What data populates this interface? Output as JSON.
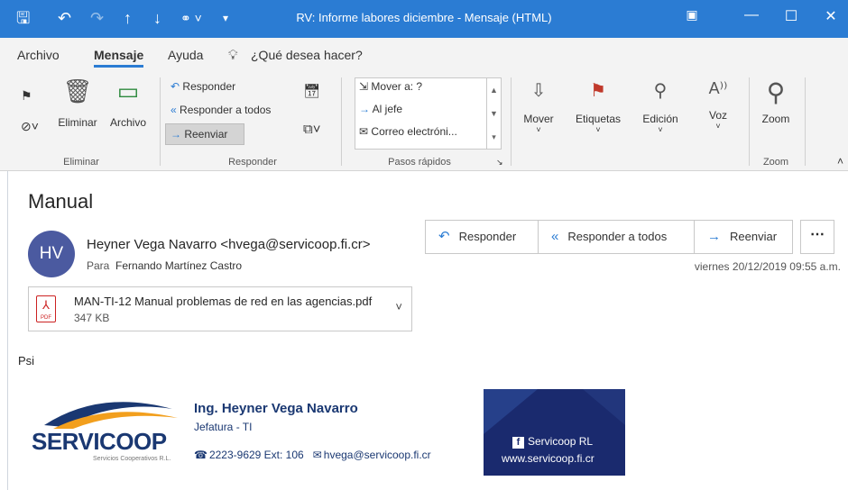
{
  "window": {
    "title": "RV: Informe labores diciembre  -  Mensaje (HTML)",
    "colors": {
      "titlebar": "#2b7cd3",
      "accent": "#2b7cd3",
      "brand_navy": "#1a3872"
    }
  },
  "menu": {
    "tabs": [
      {
        "label": "Archivo"
      },
      {
        "label": "Mensaje"
      },
      {
        "label": "Ayuda"
      }
    ],
    "tell_me": "¿Qué desea hacer?"
  },
  "ribbon": {
    "eliminar": {
      "delete_label": "Eliminar",
      "archive_label": "Archivo",
      "group": "Eliminar"
    },
    "responder": {
      "reply": "Responder",
      "reply_all": "Responder a todos",
      "forward": "Reenviar",
      "group": "Responder"
    },
    "quick_steps": {
      "items": [
        "Mover a: ?",
        "Al jefe",
        "Correo electróni..."
      ],
      "group": "Pasos rápidos"
    },
    "mover": "Mover",
    "etiquetas": "Etiquetas",
    "edicion": "Edición",
    "voz": "Voz",
    "zoom": {
      "label": "Zoom",
      "group": "Zoom"
    }
  },
  "message": {
    "subject": "Manual",
    "avatar_initials": "HV",
    "sender": "Heyner Vega Navarro <hvega@servicoop.fi.cr>",
    "to_label": "Para",
    "to": "Fernando Martínez Castro",
    "datetime": "viernes 20/12/2019 09:55 a.m.",
    "actions": {
      "reply": "Responder",
      "reply_all": "Responder a todos",
      "forward": "Reenviar"
    },
    "attachment": {
      "name": "MAN-TI-12 Manual problemas de red en las agencias.pdf",
      "size": "347 KB",
      "type_label": "PDF"
    },
    "body": "Psi"
  },
  "signature": {
    "logo_text": "SERVICOOP",
    "logo_subtitle": "Servicios Cooperativos R.L.",
    "name": "Ing. Heyner Vega Navarro",
    "role": "Jefatura - TI",
    "phone": "2223-9629 Ext: 106",
    "email": "hvega@servicoop.fi.cr",
    "facebook": "Servicoop RL",
    "website": "www.servicoop.fi.cr"
  }
}
